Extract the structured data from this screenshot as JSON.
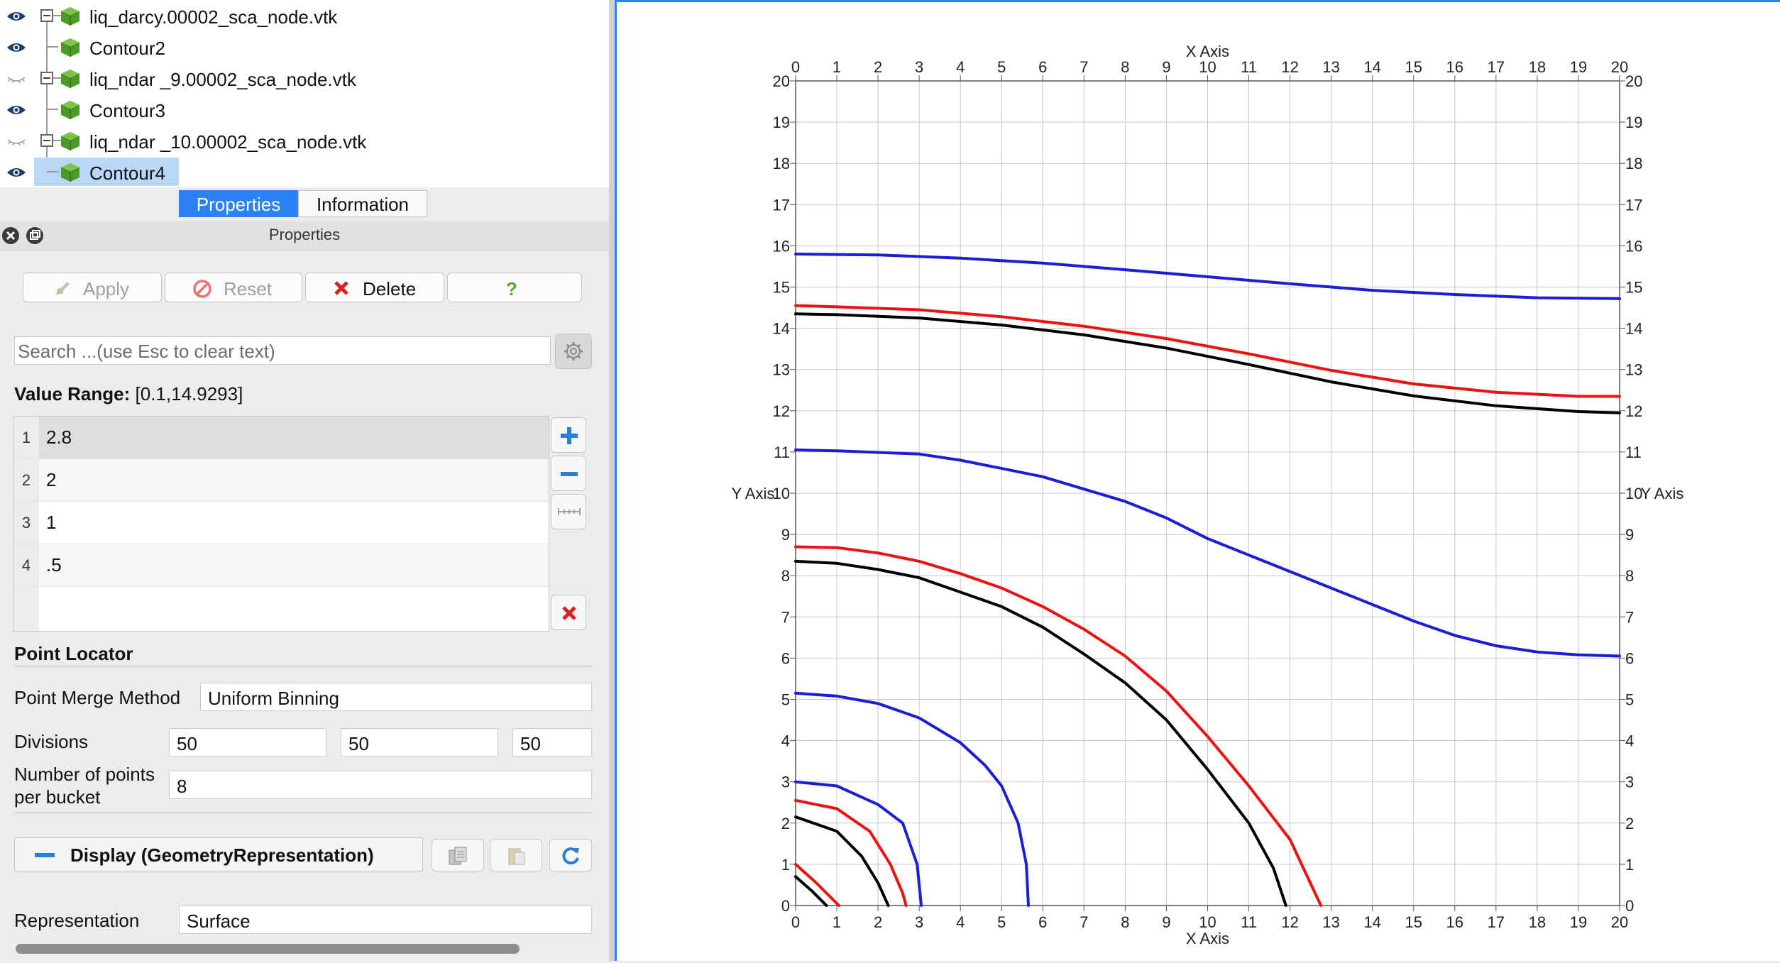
{
  "pipeline": {
    "items": [
      {
        "label": "liq_darcy.00002_sca_node.vtk",
        "visible": true,
        "expander": true
      },
      {
        "label": "Contour2",
        "visible": true,
        "expander": false
      },
      {
        "label": "liq_ndar _9.00002_sca_node.vtk",
        "visible": false,
        "expander": true
      },
      {
        "label": "Contour3",
        "visible": true,
        "expander": false
      },
      {
        "label": "liq_ndar _10.00002_sca_node.vtk",
        "visible": false,
        "expander": true
      },
      {
        "label": "Contour4",
        "visible": true,
        "expander": false,
        "selected": true
      }
    ]
  },
  "tabs": [
    {
      "label": "Properties",
      "active": true
    },
    {
      "label": "Information",
      "active": false
    }
  ],
  "panel": {
    "title": "Properties",
    "buttons": {
      "apply": "Apply",
      "reset": "Reset",
      "delete": "Delete",
      "help": "?"
    },
    "search_placeholder": "Search ...(use Esc to clear text)",
    "value_range_label": "Value Range:",
    "value_range": "[0.1,14.9293]",
    "values": [
      {
        "index": "1",
        "value": "2.8"
      },
      {
        "index": "2",
        "value": "2"
      },
      {
        "index": "3",
        "value": "1"
      },
      {
        "index": "4",
        "value": ".5"
      }
    ],
    "point_locator": {
      "title": "Point Locator",
      "merge_label": "Point Merge Method",
      "merge_value": "Uniform Binning",
      "divisions_label": "Divisions",
      "divisions": [
        "50",
        "50",
        "50"
      ],
      "bucket_label_1": "Number of points",
      "bucket_label_2": "per bucket",
      "bucket_value": "8"
    },
    "display": {
      "title": "Display (GeometryRepresentation)",
      "representation_label": "Representation",
      "representation_value": "Surface"
    }
  },
  "colors": {
    "accent": "#2a82f5",
    "blue": "#1d1dd8",
    "red": "#ee1111",
    "black": "#000000"
  },
  "chart_data": {
    "type": "line",
    "xlabel": "X Axis",
    "ylabel": "Y Axis",
    "xlim": [
      0,
      20
    ],
    "ylim": [
      0,
      20
    ],
    "xticks": [
      0,
      1,
      2,
      3,
      4,
      5,
      6,
      7,
      8,
      9,
      10,
      11,
      12,
      13,
      14,
      15,
      16,
      17,
      18,
      19,
      20
    ],
    "yticks": [
      0,
      1,
      2,
      3,
      4,
      5,
      6,
      7,
      8,
      9,
      10,
      11,
      12,
      13,
      14,
      15,
      16,
      17,
      18,
      19,
      20
    ],
    "grid": true,
    "series": [
      {
        "color": "blue",
        "points": [
          [
            0,
            15.8
          ],
          [
            2,
            15.78
          ],
          [
            4,
            15.7
          ],
          [
            6,
            15.58
          ],
          [
            8,
            15.42
          ],
          [
            10,
            15.25
          ],
          [
            12,
            15.08
          ],
          [
            14,
            14.92
          ],
          [
            16,
            14.82
          ],
          [
            18,
            14.74
          ],
          [
            20,
            14.72
          ]
        ]
      },
      {
        "color": "red",
        "points": [
          [
            0,
            14.55
          ],
          [
            1,
            14.52
          ],
          [
            3,
            14.45
          ],
          [
            5,
            14.28
          ],
          [
            7,
            14.05
          ],
          [
            9,
            13.75
          ],
          [
            11,
            13.38
          ],
          [
            13,
            12.98
          ],
          [
            15,
            12.65
          ],
          [
            17,
            12.45
          ],
          [
            19,
            12.35
          ],
          [
            20,
            12.35
          ]
        ]
      },
      {
        "color": "black",
        "points": [
          [
            0,
            14.35
          ],
          [
            1,
            14.33
          ],
          [
            3,
            14.25
          ],
          [
            5,
            14.08
          ],
          [
            7,
            13.84
          ],
          [
            9,
            13.52
          ],
          [
            11,
            13.12
          ],
          [
            13,
            12.7
          ],
          [
            15,
            12.36
          ],
          [
            17,
            12.12
          ],
          [
            19,
            11.98
          ],
          [
            20,
            11.95
          ]
        ]
      },
      {
        "color": "blue",
        "points": [
          [
            0,
            11.05
          ],
          [
            1,
            11.03
          ],
          [
            3,
            10.95
          ],
          [
            4,
            10.8
          ],
          [
            5,
            10.6
          ],
          [
            6,
            10.4
          ],
          [
            7,
            10.1
          ],
          [
            8,
            9.8
          ],
          [
            9,
            9.4
          ],
          [
            10,
            8.9
          ],
          [
            11,
            8.5
          ],
          [
            12,
            8.1
          ],
          [
            13,
            7.7
          ],
          [
            14,
            7.3
          ],
          [
            15,
            6.9
          ],
          [
            16,
            6.55
          ],
          [
            17,
            6.3
          ],
          [
            18,
            6.15
          ],
          [
            19,
            6.08
          ],
          [
            20,
            6.05
          ]
        ]
      },
      {
        "color": "red",
        "points": [
          [
            0,
            8.7
          ],
          [
            1,
            8.68
          ],
          [
            2,
            8.55
          ],
          [
            3,
            8.35
          ],
          [
            4,
            8.05
          ],
          [
            5,
            7.7
          ],
          [
            6,
            7.25
          ],
          [
            7,
            6.7
          ],
          [
            8,
            6.05
          ],
          [
            9,
            5.2
          ],
          [
            10,
            4.1
          ],
          [
            11,
            2.9
          ],
          [
            12,
            1.6
          ],
          [
            12.75,
            0
          ]
        ]
      },
      {
        "color": "black",
        "points": [
          [
            0,
            8.35
          ],
          [
            1,
            8.3
          ],
          [
            2,
            8.15
          ],
          [
            3,
            7.95
          ],
          [
            4,
            7.6
          ],
          [
            5,
            7.25
          ],
          [
            6,
            6.75
          ],
          [
            7,
            6.1
          ],
          [
            8,
            5.4
          ],
          [
            9,
            4.5
          ],
          [
            10,
            3.3
          ],
          [
            11,
            2.0
          ],
          [
            11.6,
            0.9
          ],
          [
            11.9,
            0
          ]
        ]
      },
      {
        "color": "blue",
        "points": [
          [
            0,
            5.15
          ],
          [
            1,
            5.08
          ],
          [
            2,
            4.9
          ],
          [
            3,
            4.55
          ],
          [
            4,
            3.95
          ],
          [
            4.6,
            3.4
          ],
          [
            5,
            2.9
          ],
          [
            5.4,
            2.0
          ],
          [
            5.6,
            1.0
          ],
          [
            5.65,
            0
          ]
        ]
      },
      {
        "color": "blue",
        "points": [
          [
            0,
            3.0
          ],
          [
            1,
            2.9
          ],
          [
            2,
            2.45
          ],
          [
            2.6,
            2.0
          ],
          [
            2.95,
            1.0
          ],
          [
            3.05,
            0
          ]
        ]
      },
      {
        "color": "red",
        "points": [
          [
            0,
            2.55
          ],
          [
            1,
            2.35
          ],
          [
            1.8,
            1.8
          ],
          [
            2.3,
            1.0
          ],
          [
            2.6,
            0.3
          ],
          [
            2.68,
            0
          ]
        ]
      },
      {
        "color": "black",
        "points": [
          [
            0,
            2.15
          ],
          [
            1,
            1.8
          ],
          [
            1.6,
            1.2
          ],
          [
            2.0,
            0.55
          ],
          [
            2.25,
            0
          ]
        ]
      },
      {
        "color": "red",
        "points": [
          [
            0,
            1.0
          ],
          [
            0.5,
            0.55
          ],
          [
            1.0,
            0.05
          ],
          [
            1.05,
            0
          ]
        ]
      },
      {
        "color": "black",
        "points": [
          [
            0,
            0.7
          ],
          [
            0.4,
            0.35
          ],
          [
            0.75,
            0
          ]
        ]
      }
    ]
  }
}
